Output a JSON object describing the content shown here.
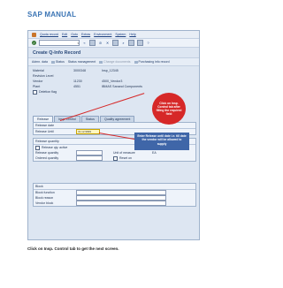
{
  "doc": {
    "title": "SAP MANUAL",
    "caption": "Click on Insp. Control tab to get the next screen."
  },
  "menubar": {
    "items": [
      "Quota record",
      "Edit",
      "Goto",
      "Extras",
      "Environment",
      "System",
      "Help"
    ]
  },
  "window": {
    "title": "Create Q-Info Record"
  },
  "app_toolbar": {
    "admin": "Admn. data",
    "status": "Status",
    "status_mgmt": "Status management",
    "change_docs": "Change documents",
    "purchasing": "Purchasing info record"
  },
  "fields": {
    "material_label": "Material",
    "material_value": "3000348",
    "material_desc": "Insp_12345",
    "revision_label": "Revision Level",
    "vendor_label": "Vendor",
    "vendor_value": "11230",
    "vendor_desc": "4500_Vendor3",
    "plant_label": "Plant",
    "plant_value": "4551",
    "plant_desc": "IBMAS Sanand Components",
    "deletion_label": "Deletion flag"
  },
  "tabs": [
    "Release",
    "Insp. control",
    "Status",
    "Quality agreement"
  ],
  "release_panel": {
    "header": "Release date",
    "until_label": "Release Until",
    "until_value": "31.12.9999"
  },
  "quantity_panel": {
    "header": "Release quantity",
    "active_label": "Release qty. active",
    "qty_label": "Release quantity",
    "unit_label": "Unit of measure",
    "unit_value": "EA",
    "ordered_label": "Ordered quantity",
    "reset_label": "Reset on"
  },
  "block_panel": {
    "header": "Block",
    "function_label": "Block function",
    "reason_label": "Block reason",
    "vendor_label": "Vendor block"
  },
  "annotations": {
    "callout": "Click on Insp. Control tab after filling the required field",
    "note": "Enter Release until date i.e. till date the vendor will be allowed to supply"
  },
  "colors": {
    "title_blue": "#3a74b4",
    "callout_red": "#d62828",
    "note_blue": "#3f66a8"
  }
}
